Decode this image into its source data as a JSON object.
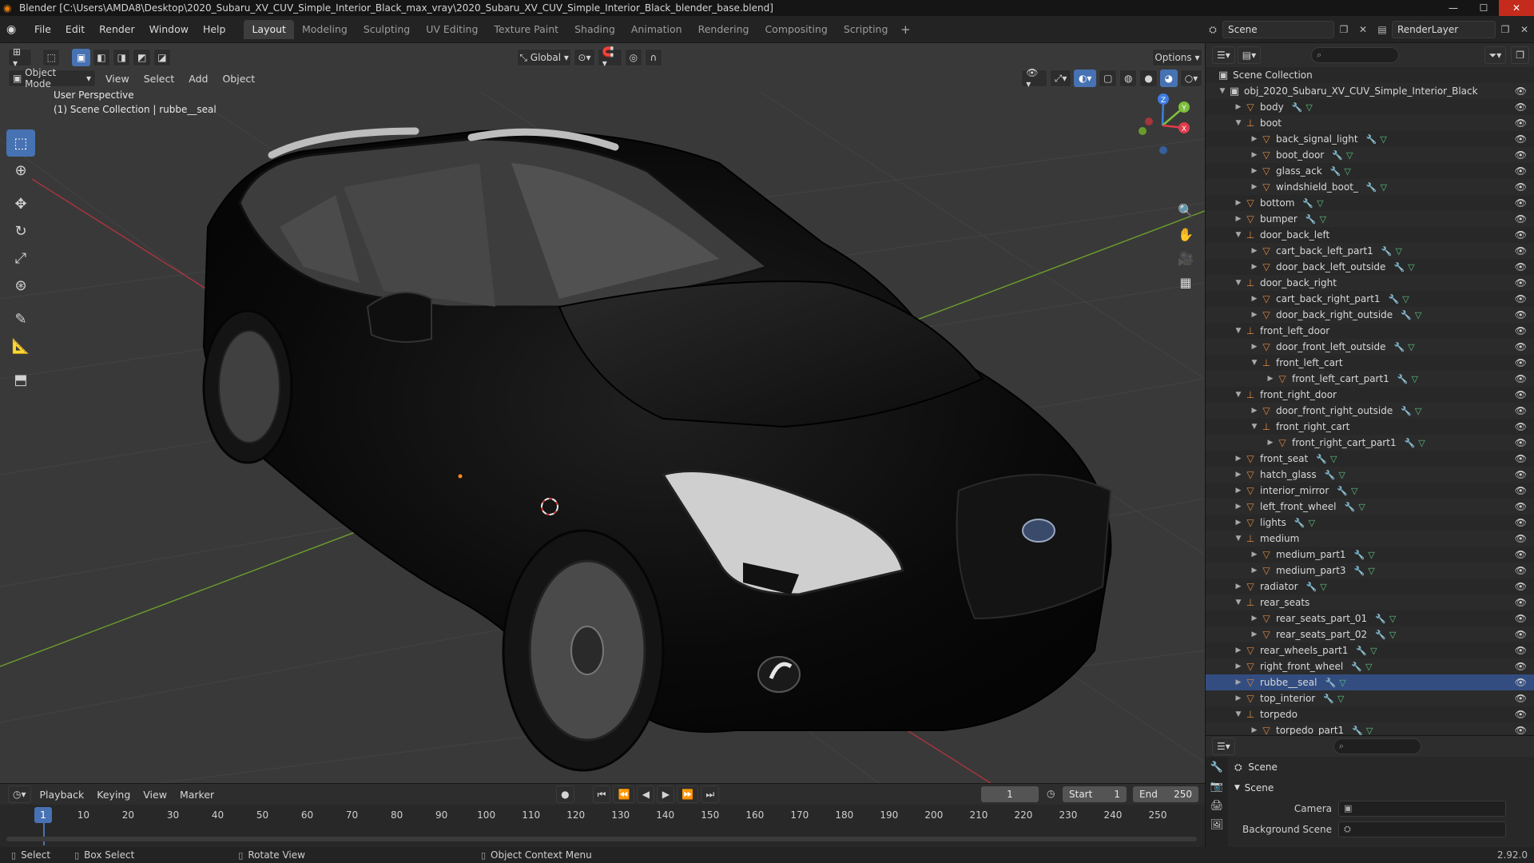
{
  "window": {
    "title": "Blender [C:\\Users\\AMDA8\\Desktop\\2020_Subaru_XV_CUV_Simple_Interior_Black_max_vray\\2020_Subaru_XV_CUV_Simple_Interior_Black_blender_base.blend]"
  },
  "menu": [
    "File",
    "Edit",
    "Render",
    "Window",
    "Help"
  ],
  "workspaces": [
    {
      "label": "Layout",
      "active": true
    },
    {
      "label": "Modeling"
    },
    {
      "label": "Sculpting"
    },
    {
      "label": "UV Editing"
    },
    {
      "label": "Texture Paint"
    },
    {
      "label": "Shading"
    },
    {
      "label": "Animation"
    },
    {
      "label": "Rendering"
    },
    {
      "label": "Compositing"
    },
    {
      "label": "Scripting"
    }
  ],
  "topright": {
    "scene": "Scene",
    "render_layer": "RenderLayer"
  },
  "viewport": {
    "mode": "Object Mode",
    "menu": [
      "View",
      "Select",
      "Add",
      "Object"
    ],
    "orientation": "Global",
    "options": "Options",
    "info_line1": "User Perspective",
    "info_line2": "(1) Scene Collection | rubbe__seal",
    "gizmo_labels": {
      "z": "Z",
      "y": "Y",
      "x": "X"
    }
  },
  "outliner": {
    "root": "Scene Collection",
    "rows": [
      {
        "name": "obj_2020_Subaru_XV_CUV_Simple_Interior_Black",
        "depth": 1,
        "kind": "collection",
        "open": true
      },
      {
        "name": "body",
        "depth": 2,
        "kind": "object"
      },
      {
        "name": "boot",
        "depth": 2,
        "kind": "empty",
        "open": true
      },
      {
        "name": "back_signal_light",
        "depth": 3,
        "kind": "object"
      },
      {
        "name": "boot_door",
        "depth": 3,
        "kind": "object"
      },
      {
        "name": "glass_ack",
        "depth": 3,
        "kind": "object"
      },
      {
        "name": "windshield_boot_",
        "depth": 3,
        "kind": "object"
      },
      {
        "name": "bottom",
        "depth": 2,
        "kind": "object"
      },
      {
        "name": "bumper",
        "depth": 2,
        "kind": "object"
      },
      {
        "name": "door_back_left",
        "depth": 2,
        "kind": "empty",
        "open": true
      },
      {
        "name": "cart_back_left_part1",
        "depth": 3,
        "kind": "object"
      },
      {
        "name": "door_back_left_outside",
        "depth": 3,
        "kind": "object"
      },
      {
        "name": "door_back_right",
        "depth": 2,
        "kind": "empty",
        "open": true
      },
      {
        "name": "cart_back_right_part1",
        "depth": 3,
        "kind": "object"
      },
      {
        "name": "door_back_right_outside",
        "depth": 3,
        "kind": "object"
      },
      {
        "name": "front_left_door",
        "depth": 2,
        "kind": "empty",
        "open": true
      },
      {
        "name": "door_front_left_outside",
        "depth": 3,
        "kind": "object"
      },
      {
        "name": "front_left_cart",
        "depth": 3,
        "kind": "empty",
        "open": true
      },
      {
        "name": "front_left_cart_part1",
        "depth": 4,
        "kind": "object"
      },
      {
        "name": "front_right_door",
        "depth": 2,
        "kind": "empty",
        "open": true
      },
      {
        "name": "door_front_right_outside",
        "depth": 3,
        "kind": "object"
      },
      {
        "name": "front_right_cart",
        "depth": 3,
        "kind": "empty",
        "open": true
      },
      {
        "name": "front_right_cart_part1",
        "depth": 4,
        "kind": "object"
      },
      {
        "name": "front_seat",
        "depth": 2,
        "kind": "object"
      },
      {
        "name": "hatch_glass",
        "depth": 2,
        "kind": "object"
      },
      {
        "name": "interior_mirror",
        "depth": 2,
        "kind": "object"
      },
      {
        "name": "left_front_wheel",
        "depth": 2,
        "kind": "object"
      },
      {
        "name": "lights",
        "depth": 2,
        "kind": "object"
      },
      {
        "name": "medium",
        "depth": 2,
        "kind": "empty",
        "open": true
      },
      {
        "name": "medium_part1",
        "depth": 3,
        "kind": "object"
      },
      {
        "name": "medium_part3",
        "depth": 3,
        "kind": "object"
      },
      {
        "name": "radiator",
        "depth": 2,
        "kind": "object"
      },
      {
        "name": "rear_seats",
        "depth": 2,
        "kind": "empty",
        "open": true
      },
      {
        "name": "rear_seats_part_01",
        "depth": 3,
        "kind": "object"
      },
      {
        "name": "rear_seats_part_02",
        "depth": 3,
        "kind": "object"
      },
      {
        "name": "rear_wheels_part1",
        "depth": 2,
        "kind": "object"
      },
      {
        "name": "right_front_wheel",
        "depth": 2,
        "kind": "object"
      },
      {
        "name": "rubbe__seal",
        "depth": 2,
        "kind": "object",
        "selected": true
      },
      {
        "name": "top_interior",
        "depth": 2,
        "kind": "object"
      },
      {
        "name": "torpedo",
        "depth": 2,
        "kind": "empty",
        "open": true
      },
      {
        "name": "torpedo_part1",
        "depth": 3,
        "kind": "object"
      }
    ]
  },
  "properties": {
    "context": "Scene",
    "panel": "Scene",
    "camera_label": "Camera",
    "background_label": "Background Scene"
  },
  "timeline": {
    "menu": [
      "Playback",
      "Keying",
      "View",
      "Marker"
    ],
    "current_frame": "1",
    "start_label": "Start",
    "start": "1",
    "end_label": "End",
    "end": "250",
    "ticks": [
      "1",
      "10",
      "20",
      "30",
      "40",
      "50",
      "60",
      "70",
      "80",
      "90",
      "100",
      "110",
      "120",
      "130",
      "140",
      "150",
      "160",
      "170",
      "180",
      "190",
      "200",
      "210",
      "220",
      "230",
      "240",
      "250"
    ]
  },
  "status": {
    "select": "Select",
    "box_select": "Box Select",
    "rotate_view": "Rotate View",
    "context_menu": "Object Context Menu",
    "version": "2.92.0"
  },
  "colors": {
    "accent": "#4772b3",
    "x_axis": "#e03b4b",
    "y_axis": "#7dbf3c",
    "z_axis": "#3e7ee0"
  }
}
